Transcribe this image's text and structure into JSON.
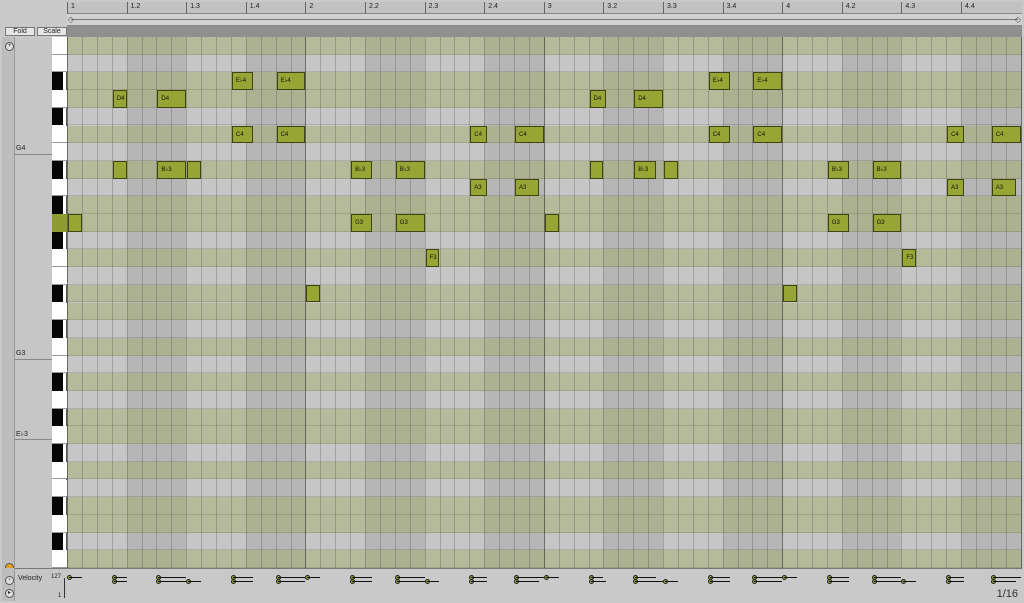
{
  "toolbar": {
    "fold_label": "Fold",
    "scale_label": "Scale"
  },
  "ruler": {
    "labels": [
      "1",
      "1.2",
      "1.3",
      "1.4",
      "2",
      "2.2",
      "2.3",
      "2.4",
      "3",
      "3.2",
      "3.3",
      "3.4",
      "4",
      "4.2",
      "4.3",
      "4.4"
    ]
  },
  "keyboard": {
    "octave_labels": [
      "G4",
      "G3",
      "E♭3"
    ]
  },
  "notes": [
    {
      "label": "",
      "pitch": "G3",
      "start": 0,
      "len": 1
    },
    {
      "label": "D4",
      "pitch": "D4",
      "start": 3,
      "len": 1
    },
    {
      "label": "",
      "pitch": "B♭3",
      "start": 3,
      "len": 1
    },
    {
      "label": "D4",
      "pitch": "D4",
      "start": 6,
      "len": 2
    },
    {
      "label": "B♭3",
      "pitch": "B♭3",
      "start": 6,
      "len": 2
    },
    {
      "label": "",
      "pitch": "B♭3",
      "start": 8,
      "len": 1
    },
    {
      "label": "E♭4",
      "pitch": "E♭4",
      "start": 11,
      "len": 1.5
    },
    {
      "label": "C4",
      "pitch": "C4",
      "start": 11,
      "len": 1.5
    },
    {
      "label": "E♭4",
      "pitch": "E♭4",
      "start": 14,
      "len": 2
    },
    {
      "label": "C4",
      "pitch": "C4",
      "start": 14,
      "len": 2
    },
    {
      "label": "",
      "pitch": "E♭3",
      "start": 16,
      "len": 1
    },
    {
      "label": "B♭3",
      "pitch": "B♭3",
      "start": 19,
      "len": 1.5
    },
    {
      "label": "G3",
      "pitch": "G3",
      "start": 19,
      "len": 1.5
    },
    {
      "label": "B♭3",
      "pitch": "B♭3",
      "start": 22,
      "len": 2
    },
    {
      "label": "G3",
      "pitch": "G3",
      "start": 22,
      "len": 2
    },
    {
      "label": "F3",
      "pitch": "F3",
      "start": 24,
      "len": 1
    },
    {
      "label": "C4",
      "pitch": "C4",
      "start": 27,
      "len": 1.2
    },
    {
      "label": "A3",
      "pitch": "A3",
      "start": 27,
      "len": 1.2
    },
    {
      "label": "C4",
      "pitch": "C4",
      "start": 30,
      "len": 2
    },
    {
      "label": "A3",
      "pitch": "A3",
      "start": 30,
      "len": 1.7
    },
    {
      "label": "",
      "pitch": "G3",
      "start": 32,
      "len": 1
    },
    {
      "label": "D4",
      "pitch": "D4",
      "start": 35,
      "len": 1.2
    },
    {
      "label": "",
      "pitch": "B♭3",
      "start": 35,
      "len": 1
    },
    {
      "label": "D4",
      "pitch": "D4",
      "start": 38,
      "len": 2
    },
    {
      "label": "B♭3",
      "pitch": "B♭3",
      "start": 38,
      "len": 1.5
    },
    {
      "label": "",
      "pitch": "B♭3",
      "start": 40,
      "len": 1
    },
    {
      "label": "E♭4",
      "pitch": "E♭4",
      "start": 43,
      "len": 1.5
    },
    {
      "label": "C4",
      "pitch": "C4",
      "start": 43,
      "len": 1.5
    },
    {
      "label": "E♭4",
      "pitch": "E♭4",
      "start": 46,
      "len": 2
    },
    {
      "label": "C4",
      "pitch": "C4",
      "start": 46,
      "len": 2
    },
    {
      "label": "",
      "pitch": "E♭3",
      "start": 48,
      "len": 1
    },
    {
      "label": "B♭3",
      "pitch": "B♭3",
      "start": 51,
      "len": 1.5
    },
    {
      "label": "G3",
      "pitch": "G3",
      "start": 51,
      "len": 1.5
    },
    {
      "label": "B♭3",
      "pitch": "B♭3",
      "start": 54,
      "len": 2
    },
    {
      "label": "G3",
      "pitch": "G3",
      "start": 54,
      "len": 2
    },
    {
      "label": "F3",
      "pitch": "F3",
      "start": 56,
      "len": 1
    },
    {
      "label": "C4",
      "pitch": "C4",
      "start": 59,
      "len": 1.2
    },
    {
      "label": "A3",
      "pitch": "A3",
      "start": 59,
      "len": 1.2
    },
    {
      "label": "C4",
      "pitch": "C4",
      "start": 62,
      "len": 2
    },
    {
      "label": "A3",
      "pitch": "A3",
      "start": 62,
      "len": 1.7
    }
  ],
  "velocity": {
    "label": "Velocity",
    "max_label": "127",
    "min_label": "1"
  },
  "grid_readout": "1/16",
  "colors": {
    "note": "#97a534",
    "root_key": "#8f9d2e"
  }
}
